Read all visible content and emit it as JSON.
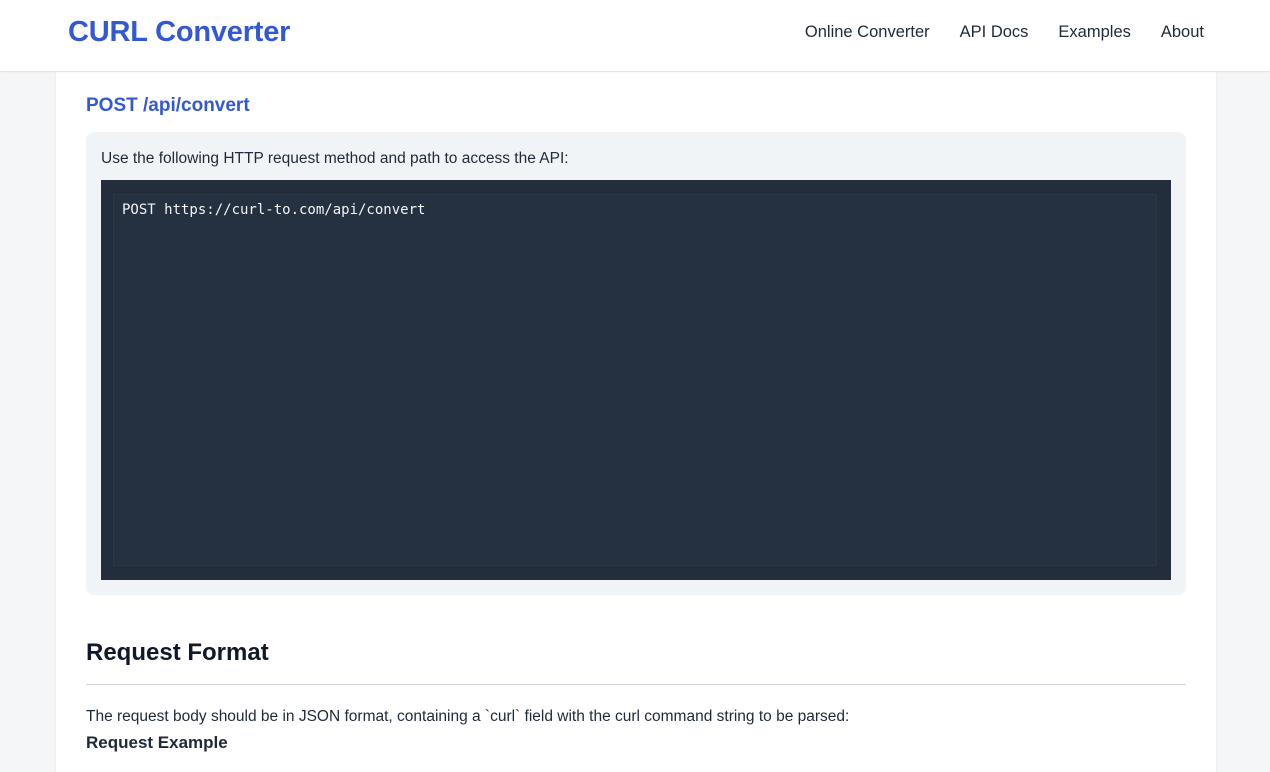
{
  "header": {
    "brand": "CURL Converter",
    "nav": [
      {
        "label": "Online Converter"
      },
      {
        "label": "API Docs"
      },
      {
        "label": "Examples"
      },
      {
        "label": "About"
      }
    ]
  },
  "endpoint": {
    "title": "POST /api/convert",
    "description": "Use the following HTTP request method and path to access the API:",
    "code": "POST https://curl-to.com/api/convert"
  },
  "request_format": {
    "title": "Request Format",
    "description": "The request body should be in JSON format, containing a `curl` field with the curl command string to be parsed:",
    "example_title": "Request Example"
  },
  "colors": {
    "accent": "#3358d4",
    "code_background": "#232d3b",
    "page_background": "#f4f6f8"
  }
}
